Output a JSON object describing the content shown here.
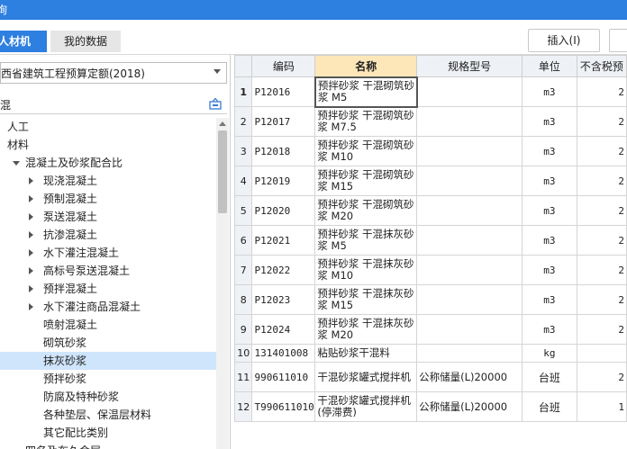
{
  "window": {
    "title": "询"
  },
  "tabs": [
    {
      "label": "人材机",
      "active": true
    },
    {
      "label": "我的数据",
      "active": false
    }
  ],
  "toolbar": {
    "insert_label": "插入(I)"
  },
  "left_panel": {
    "quota_select": {
      "value": "西省建筑工程预算定额(2018)"
    },
    "search": {
      "value": "混"
    },
    "tree": [
      {
        "label": "人工",
        "level": 0,
        "toggle": "none"
      },
      {
        "label": "材料",
        "level": 0,
        "toggle": "none"
      },
      {
        "label": "混凝土及砂浆配合比",
        "level": 1,
        "toggle": "expanded"
      },
      {
        "label": "现浇混凝土",
        "level": 2,
        "toggle": "collapsed"
      },
      {
        "label": "预制混凝土",
        "level": 2,
        "toggle": "collapsed"
      },
      {
        "label": "泵送混凝土",
        "level": 2,
        "toggle": "collapsed"
      },
      {
        "label": "抗渗混凝土",
        "level": 2,
        "toggle": "collapsed"
      },
      {
        "label": "水下灌注混凝土",
        "level": 2,
        "toggle": "collapsed"
      },
      {
        "label": "高标号泵送混凝土",
        "level": 2,
        "toggle": "collapsed"
      },
      {
        "label": "预拌混凝土",
        "level": 2,
        "toggle": "collapsed"
      },
      {
        "label": "水下灌注商品混凝土",
        "level": 2,
        "toggle": "collapsed"
      },
      {
        "label": "喷射混凝土",
        "level": 2,
        "toggle": "none"
      },
      {
        "label": "砌筑砂浆",
        "level": 2,
        "toggle": "none"
      },
      {
        "label": "抹灰砂浆",
        "level": 2,
        "toggle": "none",
        "selected": true
      },
      {
        "label": "预拌砂浆",
        "level": 2,
        "toggle": "none"
      },
      {
        "label": "防腐及特种砂浆",
        "level": 2,
        "toggle": "none"
      },
      {
        "label": "各种垫层、保温层材料",
        "level": 2,
        "toggle": "none"
      },
      {
        "label": "其它配比类别",
        "level": 2,
        "toggle": "none"
      },
      {
        "label": "四名及布久会层",
        "level": 1,
        "toggle": "none"
      }
    ]
  },
  "grid": {
    "columns": [
      "",
      "编码",
      "名称",
      "规格型号",
      "单位",
      "不含税预"
    ],
    "rows": [
      {
        "idx": "1",
        "code": "P12016",
        "name": "预拌砂浆 干混砌筑砂浆 M5",
        "spec": "",
        "unit": "m3",
        "price": "2"
      },
      {
        "idx": "2",
        "code": "P12017",
        "name": "预拌砂浆 干混砌筑砂浆 M7.5",
        "spec": "",
        "unit": "m3",
        "price": "2"
      },
      {
        "idx": "3",
        "code": "P12018",
        "name": "预拌砂浆 干混砌筑砂浆 M10",
        "spec": "",
        "unit": "m3",
        "price": "2"
      },
      {
        "idx": "4",
        "code": "P12019",
        "name": "预拌砂浆 干混砌筑砂浆 M15",
        "spec": "",
        "unit": "m3",
        "price": "2"
      },
      {
        "idx": "5",
        "code": "P12020",
        "name": "预拌砂浆 干混砌筑砂浆 M20",
        "spec": "",
        "unit": "m3",
        "price": "2"
      },
      {
        "idx": "6",
        "code": "P12021",
        "name": "预拌砂浆 干混抹灰砂浆 M5",
        "spec": "",
        "unit": "m3",
        "price": "2"
      },
      {
        "idx": "7",
        "code": "P12022",
        "name": "预拌砂浆 干混抹灰砂浆 M10",
        "spec": "",
        "unit": "m3",
        "price": "2"
      },
      {
        "idx": "8",
        "code": "P12023",
        "name": "预拌砂浆 干混抹灰砂浆 M15",
        "spec": "",
        "unit": "m3",
        "price": "2"
      },
      {
        "idx": "9",
        "code": "P12024",
        "name": "预拌砂浆 干混抹灰砂浆 M20",
        "spec": "",
        "unit": "m3",
        "price": "2"
      },
      {
        "idx": "10",
        "code": "131401008",
        "name": "粘贴砂浆干混料",
        "spec": "",
        "unit": "kg",
        "price": ""
      },
      {
        "idx": "11",
        "code": "990611010",
        "name": "干混砂浆罐式搅拌机",
        "spec": "公称储量(L)20000",
        "unit": "台班",
        "price": "2"
      },
      {
        "idx": "12",
        "code": "T990611010",
        "name": "干混砂浆罐式搅拌机(停滞费)",
        "spec": "公称储量(L)20000",
        "unit": "台班",
        "price": "1"
      }
    ]
  }
}
